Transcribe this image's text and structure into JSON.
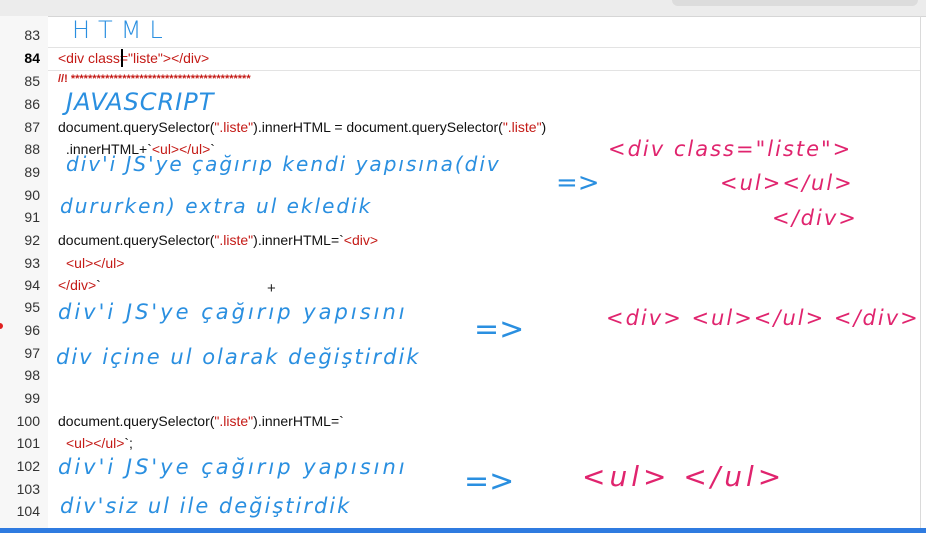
{
  "line_numbers": [
    "83",
    "84",
    "85",
    "86",
    "87",
    "88",
    "89",
    "90",
    "91",
    "92",
    "93",
    "94",
    "95",
    "96",
    "97",
    "98",
    "99",
    "100",
    "101",
    "102",
    "103",
    "104"
  ],
  "active_line": "84",
  "code": {
    "l84_open": "<div class=",
    "l84_val": "\"liste\"",
    "l84_close": "></div>",
    "l85": "//! ******************************************",
    "l87_a": "document.querySelector(",
    "l87_s1": "\".liste\"",
    "l87_b": ").innerHTML = document.querySelector(",
    "l87_s2": "\".liste\"",
    "l87_c": ")",
    "l88_a": " .innerHTML+`",
    "l88_b": "<ul></ul>",
    "l88_c": "`",
    "l92_a": "document.querySelector(",
    "l92_s": "\".liste\"",
    "l92_b": ").innerHTML=`",
    "l92_c": "<div>",
    "l93": "<ul></ul>",
    "l94_a": "</div>",
    "l94_b": "`",
    "l100_a": "document.querySelector(",
    "l100_s": "\".liste\"",
    "l100_b": ").innerHTML=`",
    "l101_a": "<ul></ul>",
    "l101_b": "`;"
  },
  "handwriting": {
    "html_heading": "HTML",
    "js_heading": "JAVASCRIPT",
    "note1_line1": "div'i JS'ye çağırıp kendi yapısına(div",
    "note1_line2": "dururken) extra ul ekledik",
    "arrow": "=>",
    "result1_line1": "<div class=\"liste\">",
    "result1_line2": "<ul></ul>",
    "result1_line3": "</div>",
    "note2_line1": "div'i JS'ye çağırıp yapısını",
    "note2_line2": "div içine ul olarak değiştirdik",
    "result2": "<div> <ul></ul> </div>",
    "note3_line1": "div'i JS'ye çağırıp yapısını",
    "note3_line2": "div'siz ul ile değiştirdik",
    "result3": "<ul> </ul>"
  },
  "colors": {
    "handwriting_blue": "#2a8fe0",
    "handwriting_magenta": "#e0246e",
    "code_string": "#c41a16"
  }
}
